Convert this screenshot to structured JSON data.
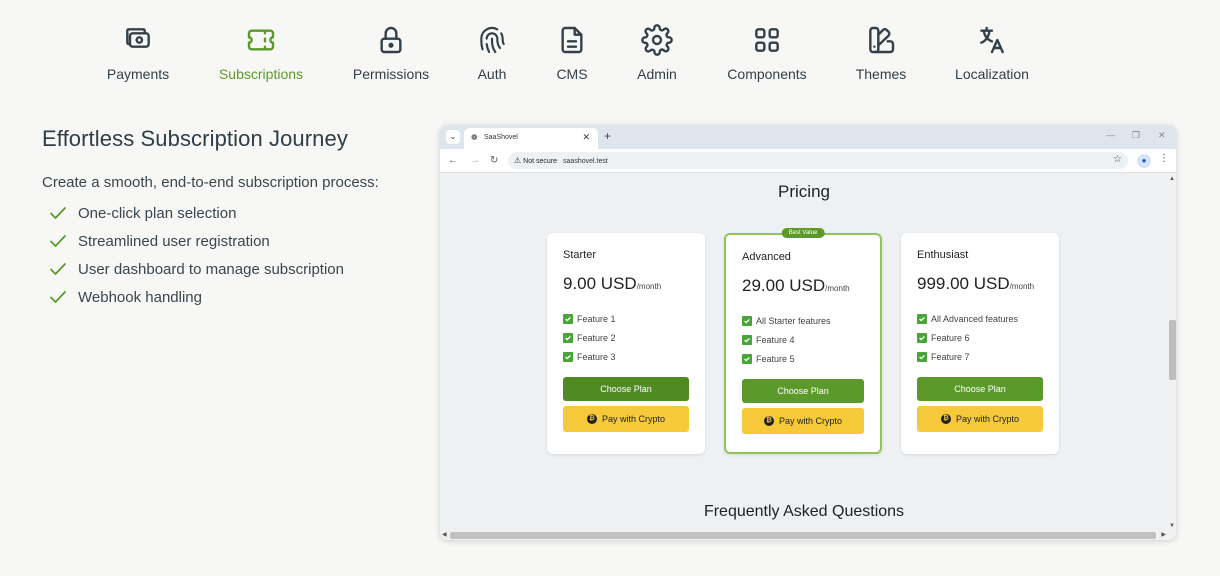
{
  "nav": {
    "items": [
      {
        "label": "Payments",
        "icon": "payments-icon"
      },
      {
        "label": "Subscriptions",
        "icon": "ticket-icon",
        "active": true
      },
      {
        "label": "Permissions",
        "icon": "lock-icon"
      },
      {
        "label": "Auth",
        "icon": "fingerprint-icon"
      },
      {
        "label": "CMS",
        "icon": "document-icon"
      },
      {
        "label": "Admin",
        "icon": "gear-icon"
      },
      {
        "label": "Components",
        "icon": "grid-icon"
      },
      {
        "label": "Themes",
        "icon": "theme-icon"
      },
      {
        "label": "Localization",
        "icon": "translate-icon"
      }
    ],
    "active_color": "#5b9a2a"
  },
  "feature_section": {
    "title": "Effortless Subscription Journey",
    "intro": "Create a smooth, end-to-end subscription process:",
    "bullets": [
      "One-click plan selection",
      "Streamlined user registration",
      "User dashboard to manage subscription",
      "Webhook handling"
    ]
  },
  "browser": {
    "tab_title": "SaaShovel",
    "security_label": "Not secure",
    "url": "saashovel.test",
    "page": {
      "heading": "Pricing",
      "faq_heading": "Frequently Asked Questions",
      "plans": [
        {
          "name": "Starter",
          "price": "9.00 USD",
          "period": "/month",
          "features": [
            "Feature 1",
            "Feature 2",
            "Feature 3"
          ],
          "choose_label": "Choose Plan",
          "crypto_label": "Pay with Crypto"
        },
        {
          "name": "Advanced",
          "badge": "Best Value",
          "price": "29.00 USD",
          "period": "/month",
          "features": [
            "All Starter features",
            "Feature 4",
            "Feature 5"
          ],
          "choose_label": "Choose Plan",
          "crypto_label": "Pay with Crypto"
        },
        {
          "name": "Enthusiast",
          "price": "999.00 USD",
          "period": "/month",
          "features": [
            "All Advanced features",
            "Feature 6",
            "Feature 7"
          ],
          "choose_label": "Choose Plan",
          "crypto_label": "Pay with Crypto"
        }
      ]
    }
  },
  "colors": {
    "brand_green": "#5b9a2a",
    "crypto_yellow": "#f5c93a",
    "check_green": "#4aa538"
  }
}
